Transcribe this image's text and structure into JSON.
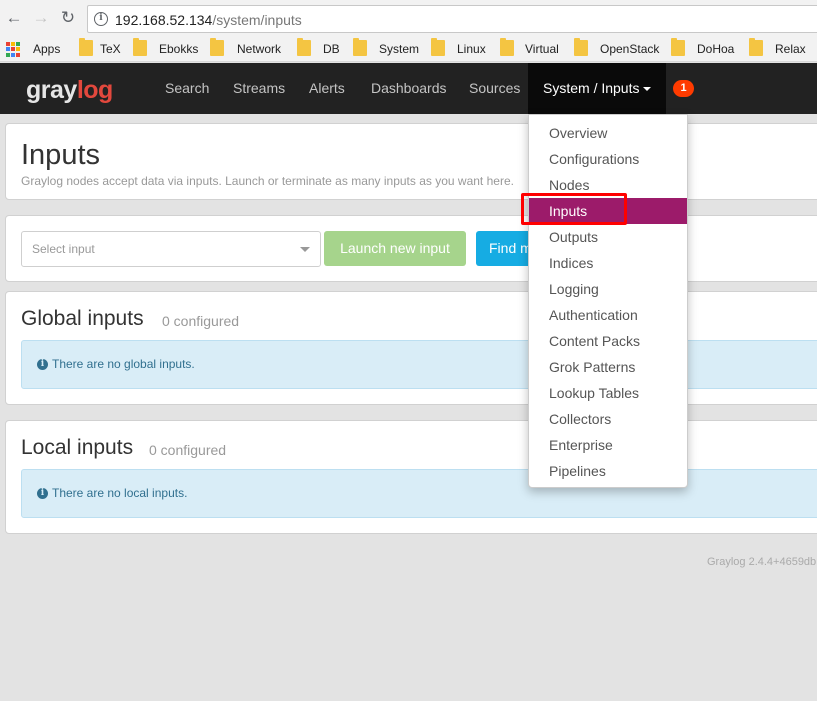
{
  "browser": {
    "url_host": "192.168.52.134",
    "url_path": "/system/inputs",
    "bookmarks": [
      {
        "label": "Apps",
        "type": "apps"
      },
      {
        "label": "TeX",
        "type": "folder"
      },
      {
        "label": "Ebokks",
        "type": "folder"
      },
      {
        "label": "Network",
        "type": "folder"
      },
      {
        "label": "DB",
        "type": "folder"
      },
      {
        "label": "System",
        "type": "folder"
      },
      {
        "label": "Linux",
        "type": "folder"
      },
      {
        "label": "Virtual",
        "type": "folder"
      },
      {
        "label": "OpenStack",
        "type": "folder"
      },
      {
        "label": "DoHoa",
        "type": "folder"
      },
      {
        "label": "Relax",
        "type": "folder"
      }
    ],
    "apps_colors": [
      "#ea4335",
      "#fbbc05",
      "#34a853",
      "#4285f4",
      "#ea4335",
      "#fbbc05",
      "#34a853",
      "#4285f4",
      "#ea4335"
    ]
  },
  "navbar": {
    "logo_gray": "gray",
    "logo_red": "log",
    "links": [
      "Search",
      "Streams",
      "Alerts",
      "Dashboards",
      "Sources"
    ],
    "active": "System / Inputs",
    "badge": "1"
  },
  "page": {
    "title": "Inputs",
    "subtitle": "Graylog nodes accept data via inputs. Launch or terminate as many inputs as you want here.",
    "select_placeholder": "Select input",
    "launch_label": "Launch new input",
    "find_label": "Find more inputs",
    "global_title": "Global inputs",
    "global_count": "0 configured",
    "global_msg": "There are no global inputs.",
    "local_title": "Local inputs",
    "local_count": "0 configured",
    "local_msg": "There are no local inputs.",
    "footer": "Graylog 2.4.4+4659db"
  },
  "dropdown": {
    "items": [
      "Overview",
      "Configurations",
      "Nodes",
      "Inputs",
      "Outputs",
      "Indices",
      "Logging",
      "Authentication",
      "Content Packs",
      "Grok Patterns",
      "Lookup Tables",
      "Collectors",
      "Enterprise",
      "Pipelines"
    ],
    "active_index": 3
  },
  "colors": {
    "active_menu": "#9c1b6a",
    "launch_button": "#a6d48c",
    "find_button": "#16ace3",
    "badge": "#ff3b00",
    "highlight": "#ff0000"
  }
}
